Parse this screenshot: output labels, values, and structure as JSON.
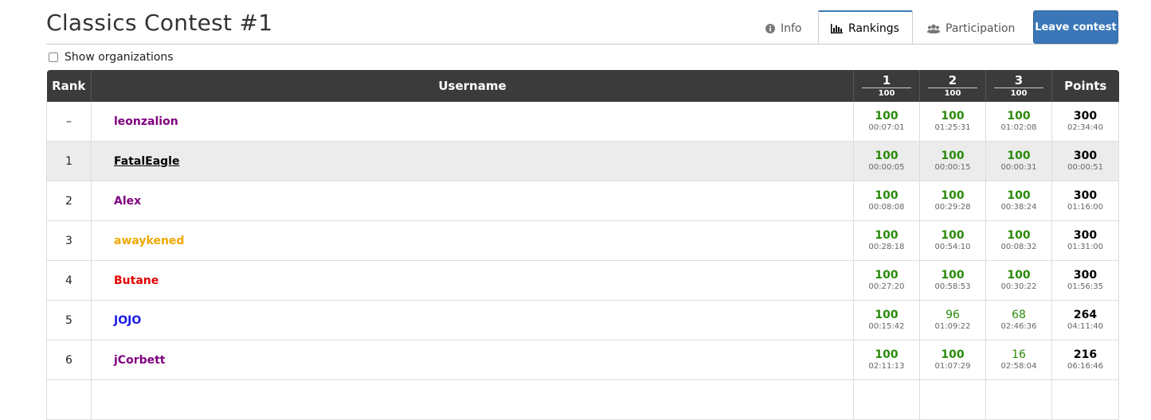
{
  "contest": {
    "title": "Classics Contest #1"
  },
  "tabs": [
    {
      "label": "Info",
      "icon": "info-circle-icon"
    },
    {
      "label": "Rankings",
      "icon": "bar-chart-icon"
    },
    {
      "label": "Participation",
      "icon": "users-icon"
    }
  ],
  "leave_button": "Leave contest",
  "show_orgs_label": "Show organizations",
  "columns": {
    "rank": "Rank",
    "username": "Username",
    "problems": [
      {
        "num": "1",
        "points": "100"
      },
      {
        "num": "2",
        "points": "100"
      },
      {
        "num": "3",
        "points": "100"
      }
    ],
    "points": "Points"
  },
  "user_colors": {
    "purple": "#800080",
    "orange": "#f0a800",
    "red": "#e00000",
    "blue": "#1a1ae6",
    "black": "#000000"
  },
  "rows": [
    {
      "rank": "–",
      "username": "leonzalion",
      "color": "#800080",
      "underline": false,
      "cells": [
        {
          "score": "100",
          "time": "00:07:01",
          "full": true
        },
        {
          "score": "100",
          "time": "01:25:31",
          "full": true
        },
        {
          "score": "100",
          "time": "01:02:08",
          "full": true
        }
      ],
      "points": "300",
      "total_time": "02:34:40"
    },
    {
      "rank": "1",
      "username": "FatalEagle",
      "color": "#000000",
      "underline": true,
      "cells": [
        {
          "score": "100",
          "time": "00:00:05",
          "full": true
        },
        {
          "score": "100",
          "time": "00:00:15",
          "full": true
        },
        {
          "score": "100",
          "time": "00:00:31",
          "full": true
        }
      ],
      "points": "300",
      "total_time": "00:00:51"
    },
    {
      "rank": "2",
      "username": "Alex",
      "color": "#800080",
      "underline": false,
      "cells": [
        {
          "score": "100",
          "time": "00:08:08",
          "full": true
        },
        {
          "score": "100",
          "time": "00:29:28",
          "full": true
        },
        {
          "score": "100",
          "time": "00:38:24",
          "full": true
        }
      ],
      "points": "300",
      "total_time": "01:16:00"
    },
    {
      "rank": "3",
      "username": "awaykened",
      "color": "#f0a800",
      "underline": false,
      "cells": [
        {
          "score": "100",
          "time": "00:28:18",
          "full": true
        },
        {
          "score": "100",
          "time": "00:54:10",
          "full": true
        },
        {
          "score": "100",
          "time": "00:08:32",
          "full": true
        }
      ],
      "points": "300",
      "total_time": "01:31:00"
    },
    {
      "rank": "4",
      "username": "Butane",
      "color": "#e00000",
      "underline": false,
      "cells": [
        {
          "score": "100",
          "time": "00:27:20",
          "full": true
        },
        {
          "score": "100",
          "time": "00:58:53",
          "full": true
        },
        {
          "score": "100",
          "time": "00:30:22",
          "full": true
        }
      ],
      "points": "300",
      "total_time": "01:56:35"
    },
    {
      "rank": "5",
      "username": "JOJO",
      "color": "#1a1ae6",
      "underline": false,
      "cells": [
        {
          "score": "100",
          "time": "00:15:42",
          "full": true
        },
        {
          "score": "96",
          "time": "01:09:22",
          "full": false
        },
        {
          "score": "68",
          "time": "02:46:36",
          "full": false
        }
      ],
      "points": "264",
      "total_time": "04:11:40"
    },
    {
      "rank": "6",
      "username": "jCorbett",
      "color": "#800080",
      "underline": false,
      "cells": [
        {
          "score": "100",
          "time": "02:11:13",
          "full": true
        },
        {
          "score": "100",
          "time": "01:07:29",
          "full": true
        },
        {
          "score": "16",
          "time": "02:58:04",
          "full": false
        }
      ],
      "points": "216",
      "total_time": "06:16:46"
    },
    {
      "rank": "",
      "username": "",
      "color": "#000000",
      "underline": false,
      "cells": [
        {
          "score": "",
          "time": "",
          "full": true
        },
        {
          "score": "",
          "time": "",
          "full": true
        },
        {
          "score": "",
          "time": "",
          "full": true
        }
      ],
      "points": "",
      "total_time": ""
    }
  ],
  "highlight_row": 1
}
